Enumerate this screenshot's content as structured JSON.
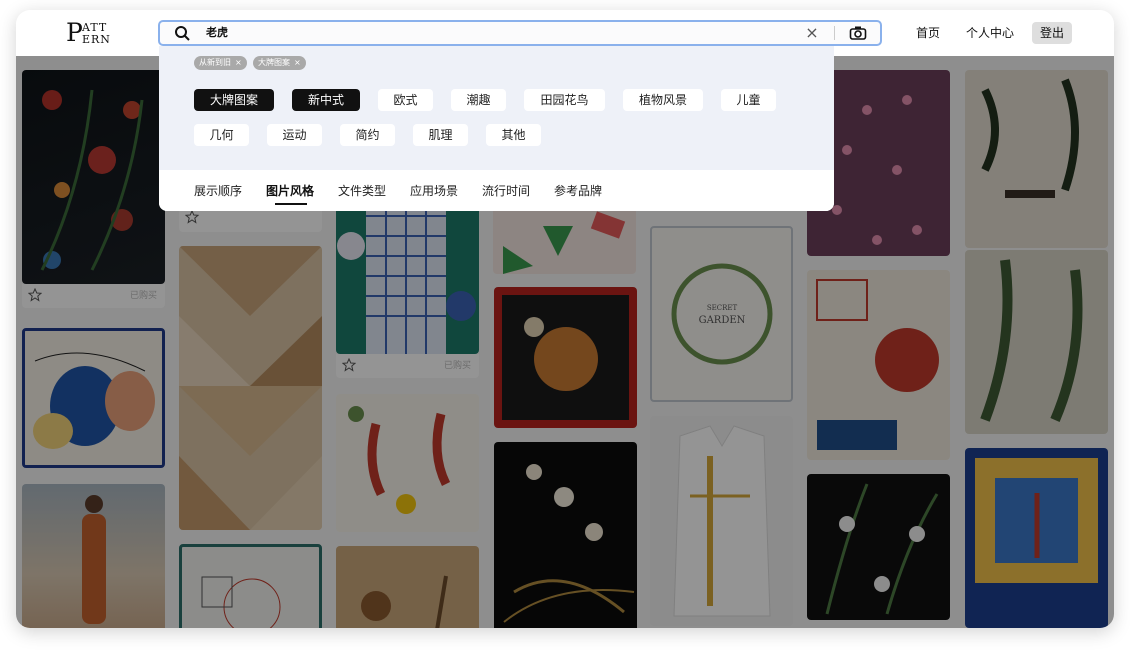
{
  "logo": {
    "big": "P",
    "line1": "ATT",
    "line2": "ERN"
  },
  "search": {
    "value": "老虎",
    "clear_glyph": "×"
  },
  "nav": {
    "home": "首页",
    "profile": "个人中心",
    "logout": "登出"
  },
  "filters": {
    "active_chips": [
      {
        "label": "从新到旧",
        "x": "×"
      },
      {
        "label": "大牌图案",
        "x": "×"
      }
    ],
    "style_tags": [
      "大牌图案",
      "新中式",
      "欧式",
      "潮趣",
      "田园花鸟",
      "植物风景",
      "儿童",
      "几何",
      "运动",
      "简约",
      "肌理",
      "其他"
    ],
    "selected_tags": [
      "大牌图案",
      "新中式"
    ],
    "categories": [
      "展示顺序",
      "图片风格",
      "文件类型",
      "应用场景",
      "流行时间",
      "参考品牌"
    ],
    "active_category": "图片风格"
  },
  "gallery": {
    "bought_label": "已购买"
  },
  "colors": {
    "accent": "#8ab1ec",
    "selected_tag": "#111111",
    "dropdown_bg": "#eef1f8",
    "overlay": "rgba(0,0,0,0.42)"
  }
}
